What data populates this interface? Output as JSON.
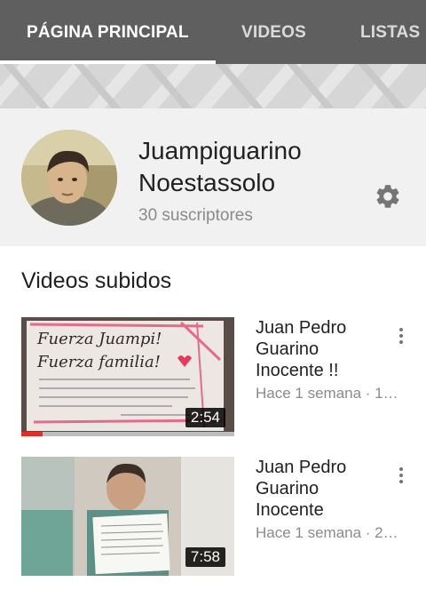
{
  "tabs": [
    {
      "label": "PÁGINA PRINCIPAL",
      "active": true
    },
    {
      "label": "VIDEOS",
      "active": false
    },
    {
      "label": "LISTAS",
      "active": false
    }
  ],
  "channel": {
    "name": "Juampiguarino Noestassolo",
    "subscribers": "30 suscriptores",
    "settings_icon": "gear-icon"
  },
  "section": {
    "title": "Videos subidos"
  },
  "videos": [
    {
      "title": "Juan Pedro Guarino Inocente !!",
      "meta": "Hace 1 semana · 1…",
      "duration": "2:54",
      "progress": 0.1,
      "thumbnail_text": {
        "line1": "Fuerza Juampi!",
        "line2": "Fuerza familia!"
      }
    },
    {
      "title": "Juan Pedro Guarino Inocente",
      "meta": "Hace 1 semana · 2…",
      "duration": "7:58"
    }
  ],
  "colors": {
    "tab_bar": "#5f5f5f",
    "header_bg": "#f1f1f1",
    "progress": "#e52d27"
  }
}
